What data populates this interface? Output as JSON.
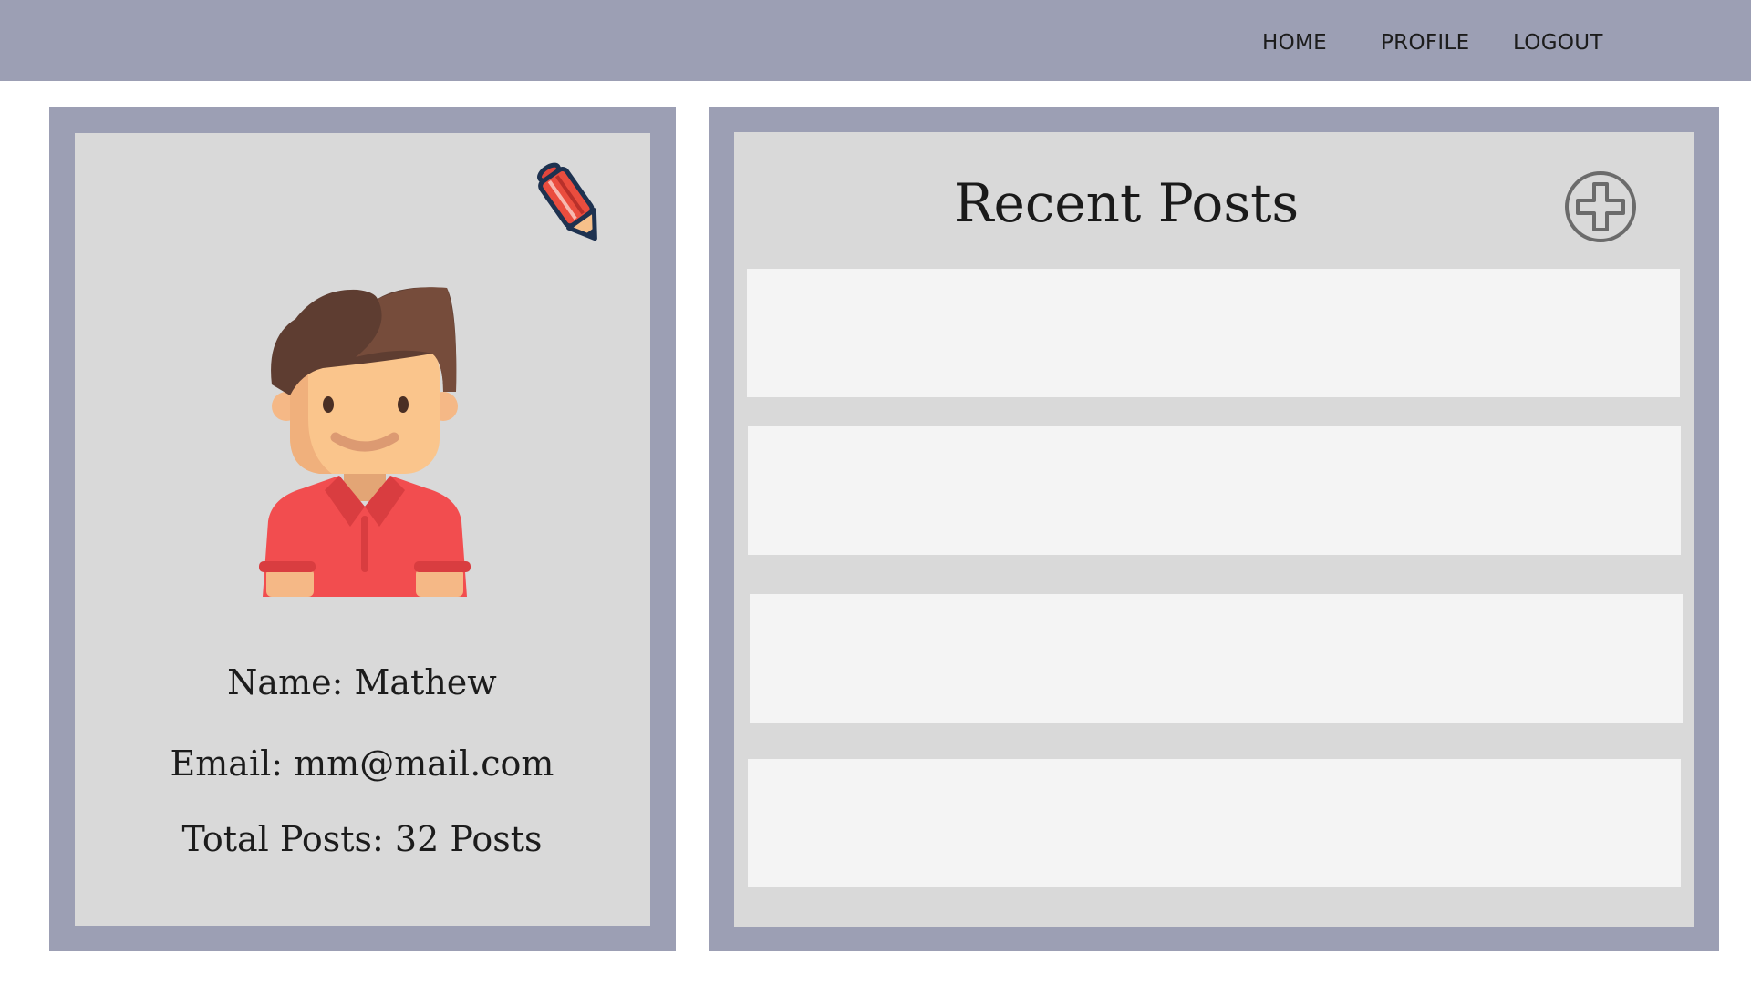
{
  "nav": {
    "home": "HOME",
    "profile": "PROFILE",
    "logout": "LOGOUT"
  },
  "profile": {
    "name_line": "Name: Mathew",
    "email_line": "Email: mm@mail.com",
    "posts_line": "Total Posts: 32 Posts"
  },
  "posts": {
    "title": "Recent Posts",
    "items": [
      "",
      "",
      "",
      ""
    ]
  },
  "icons": {
    "edit": "pencil-icon",
    "add": "plus-circle-icon",
    "avatar": "user-avatar"
  },
  "colors": {
    "frame": "#9c9fb4",
    "panel": "#d9d9d9",
    "card": "#f4f4f4",
    "text": "#1c1c1c"
  }
}
